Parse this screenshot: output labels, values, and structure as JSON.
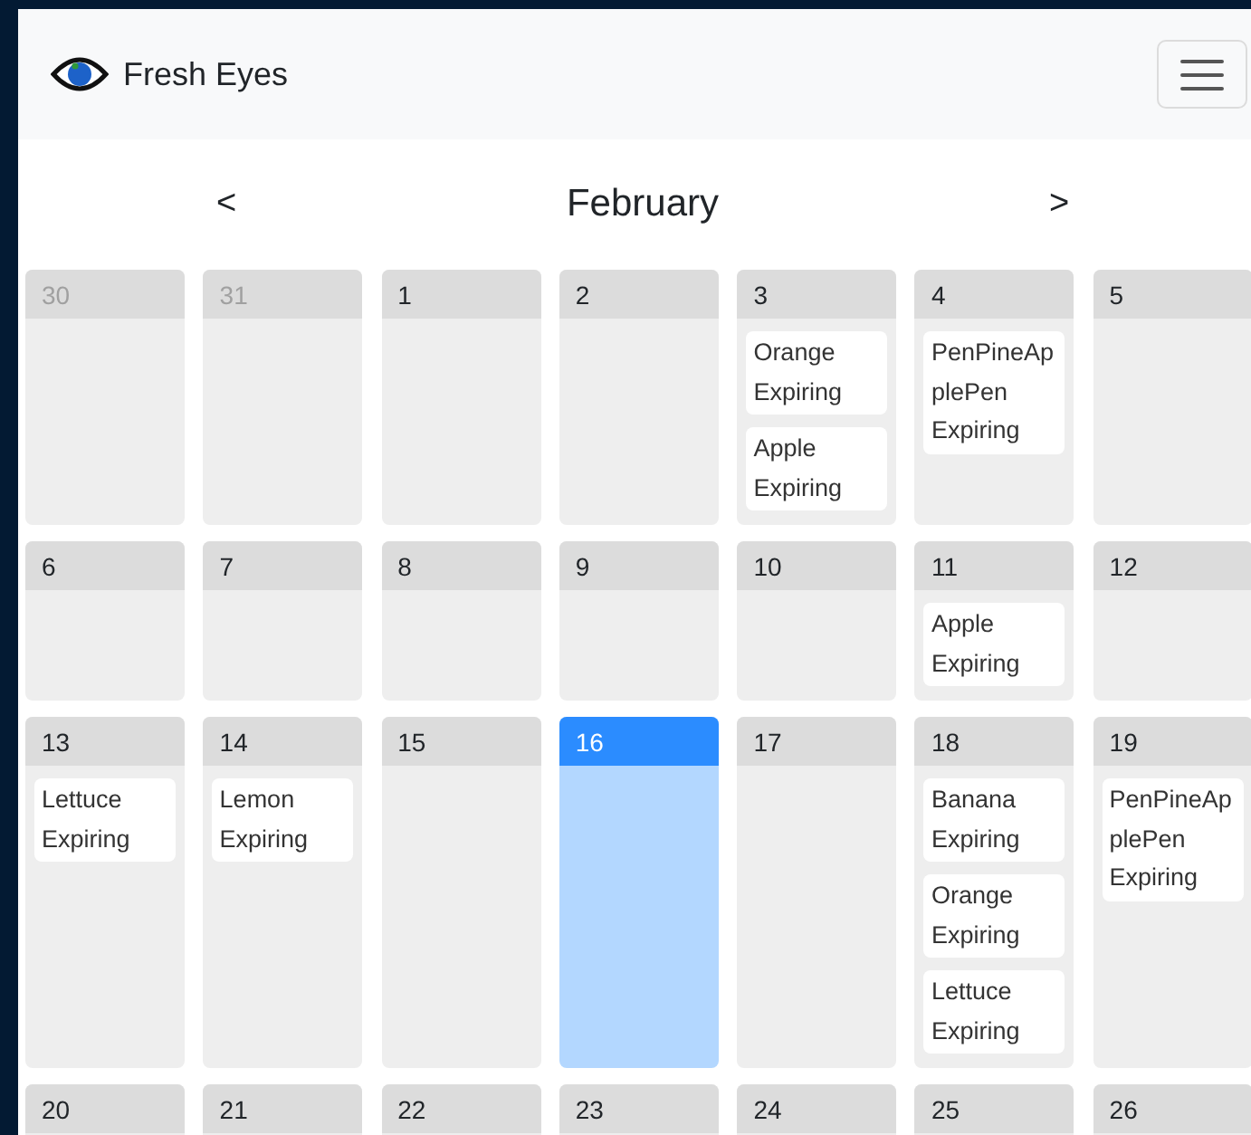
{
  "navbar": {
    "brand": "Fresh Eyes"
  },
  "month_nav": {
    "prev": "<",
    "title": "February",
    "next": ">"
  },
  "weeks": [
    [
      {
        "day": "30",
        "muted": true,
        "selected": false
      },
      {
        "day": "31",
        "muted": true,
        "selected": false
      },
      {
        "day": "1",
        "muted": false,
        "selected": false
      },
      {
        "day": "2",
        "muted": false,
        "selected": false
      },
      {
        "day": "3",
        "muted": false,
        "selected": false,
        "events": [
          {
            "name": "Orange",
            "status": "Expiring"
          },
          {
            "name": "Apple",
            "status": "Expiring"
          }
        ]
      },
      {
        "day": "4",
        "muted": false,
        "selected": false,
        "events": [
          {
            "name": "PenPineApplePen",
            "status": "Expiring"
          }
        ]
      },
      {
        "day": "5",
        "muted": false,
        "selected": false
      }
    ],
    [
      {
        "day": "6",
        "muted": false,
        "selected": false
      },
      {
        "day": "7",
        "muted": false,
        "selected": false
      },
      {
        "day": "8",
        "muted": false,
        "selected": false
      },
      {
        "day": "9",
        "muted": false,
        "selected": false
      },
      {
        "day": "10",
        "muted": false,
        "selected": false
      },
      {
        "day": "11",
        "muted": false,
        "selected": false,
        "events": [
          {
            "name": "Apple",
            "status": "Expiring"
          }
        ]
      },
      {
        "day": "12",
        "muted": false,
        "selected": false
      }
    ],
    [
      {
        "day": "13",
        "muted": false,
        "selected": false,
        "events": [
          {
            "name": "Lettuce",
            "status": "Expiring"
          }
        ]
      },
      {
        "day": "14",
        "muted": false,
        "selected": false,
        "events": [
          {
            "name": "Lemon",
            "status": "Expiring"
          }
        ]
      },
      {
        "day": "15",
        "muted": false,
        "selected": false
      },
      {
        "day": "16",
        "muted": false,
        "selected": true
      },
      {
        "day": "17",
        "muted": false,
        "selected": false
      },
      {
        "day": "18",
        "muted": false,
        "selected": false,
        "events": [
          {
            "name": "Banana",
            "status": "Expiring"
          },
          {
            "name": "Orange",
            "status": "Expiring"
          },
          {
            "name": "Lettuce",
            "status": "Expiring"
          }
        ]
      },
      {
        "day": "19",
        "muted": false,
        "selected": false,
        "events": [
          {
            "name": "PenPineApplePen",
            "status": "Expiring"
          }
        ]
      }
    ],
    [
      {
        "day": "20",
        "muted": false,
        "selected": false
      },
      {
        "day": "21",
        "muted": false,
        "selected": false
      },
      {
        "day": "22",
        "muted": false,
        "selected": false
      },
      {
        "day": "23",
        "muted": false,
        "selected": false
      },
      {
        "day": "24",
        "muted": false,
        "selected": false
      },
      {
        "day": "25",
        "muted": false,
        "selected": false
      },
      {
        "day": "26",
        "muted": false,
        "selected": false
      }
    ]
  ]
}
